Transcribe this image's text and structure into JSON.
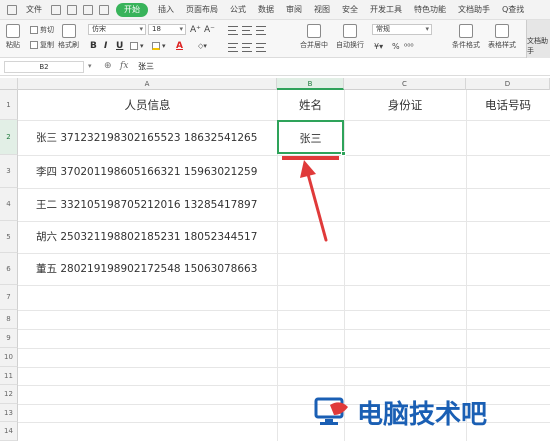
{
  "menubar": {
    "file_label": "文件",
    "tabs": [
      "开始",
      "插入",
      "页面布局",
      "公式",
      "数据",
      "审阅",
      "视图",
      "安全",
      "开发工具",
      "特色功能",
      "文档助手"
    ],
    "active_tab": "开始",
    "search_label": "Q查找"
  },
  "ribbon": {
    "paste_label": "粘贴",
    "cut_label": "剪切",
    "copy_label": "复制",
    "format_painter_label": "格式刷",
    "font_name": "仿宋",
    "font_size": "18",
    "bold": "B",
    "italic": "I",
    "underline": "U",
    "font_color_letter": "A",
    "merge_label": "合并居中",
    "wrap_label": "自动换行",
    "number_format": "常规",
    "percent": "%",
    "conditional_label": "条件格式",
    "table_style_label": "表格样式",
    "doc_assistant_label": "文档助手",
    "accent_color": "#38b35a"
  },
  "formula_bar": {
    "name_box": "B2",
    "fx": "fx",
    "content": "张三"
  },
  "sheet": {
    "columns": [
      "A",
      "B",
      "C",
      "D"
    ],
    "selected_column": "B",
    "selected_row": "2",
    "row_numbers": [
      "1",
      "2",
      "3",
      "4",
      "5",
      "6",
      "7",
      "8",
      "9",
      "10",
      "11",
      "12",
      "13",
      "14"
    ],
    "headers": {
      "a": "人员信息",
      "b": "姓名",
      "c": "身份证",
      "d": "电话号码"
    },
    "rows": [
      {
        "a": "张三  371232198302165523  18632541265",
        "b": "张三"
      },
      {
        "a": "李四  370201198605166321  15963021259",
        "b": ""
      },
      {
        "a": "王二  332105198705212016  13285417897",
        "b": ""
      },
      {
        "a": "胡六  250321198802185231  18052344517",
        "b": ""
      },
      {
        "a": "董五  280219198902172548  15063078663",
        "b": ""
      }
    ],
    "selection_color": "#2ea35a",
    "annotation_color": "#e03a3a"
  },
  "watermark": {
    "text": "电脑技术吧",
    "color": "#1a5fb4"
  }
}
